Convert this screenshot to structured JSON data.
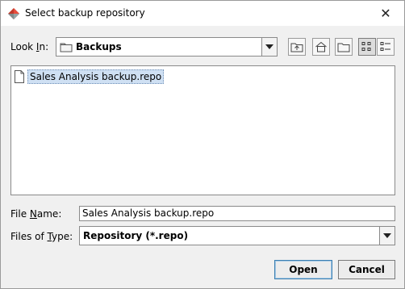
{
  "window": {
    "title": "Select backup repository",
    "close_glyph": "✕"
  },
  "look_in": {
    "label_prefix": "Look ",
    "label_mnemonic": "I",
    "label_suffix": "n:",
    "selected": "Backups"
  },
  "toolbar": {
    "buttons": [
      {
        "icon": "up-one-level-icon"
      },
      {
        "icon": "home-icon"
      },
      {
        "icon": "new-folder-icon"
      },
      {
        "icon": "list-view-icon",
        "pressed": true
      },
      {
        "icon": "details-view-icon"
      }
    ]
  },
  "files": [
    {
      "name": "Sales Analysis backup.repo",
      "selected": true
    }
  ],
  "file_name": {
    "label_prefix": "File ",
    "label_mnemonic": "N",
    "label_suffix": "ame:",
    "value": "Sales Analysis backup.repo"
  },
  "file_type": {
    "label_prefix": "Files of ",
    "label_mnemonic": "T",
    "label_suffix": "ype:",
    "selected": "Repository (*.repo)"
  },
  "buttons": {
    "open": "Open",
    "cancel": "Cancel"
  }
}
